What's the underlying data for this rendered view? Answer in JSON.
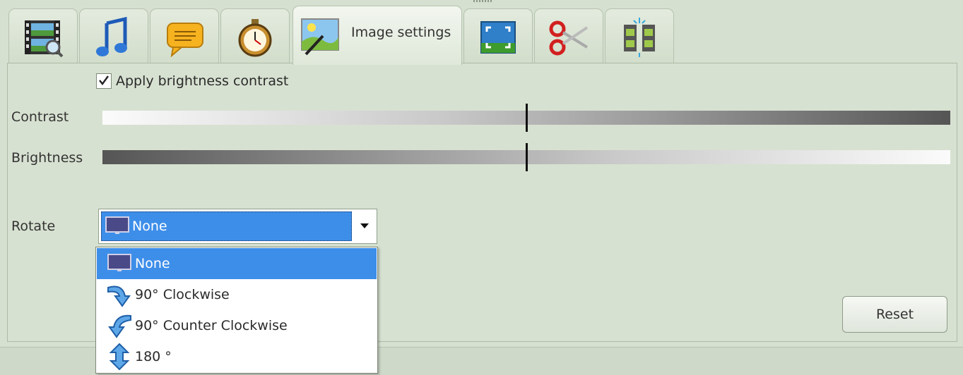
{
  "tabs": [
    {
      "icon": "video-file-icon",
      "label": ""
    },
    {
      "icon": "music-note-icon",
      "label": ""
    },
    {
      "icon": "subtitle-speech-icon",
      "label": ""
    },
    {
      "icon": "stopwatch-icon",
      "label": ""
    },
    {
      "icon": "image-settings-icon",
      "label": "Image settings",
      "active": true
    },
    {
      "icon": "crop-resize-icon",
      "label": ""
    },
    {
      "icon": "scissors-icon",
      "label": ""
    },
    {
      "icon": "film-split-icon",
      "label": ""
    }
  ],
  "image_settings": {
    "apply_brightness_contrast_label": "Apply brightness contrast",
    "apply_brightness_contrast_checked": true,
    "contrast_label": "Contrast",
    "contrast_value": 0.5,
    "brightness_label": "Brightness",
    "brightness_value": 0.5,
    "rotate_label": "Rotate",
    "rotate_selected": "None",
    "rotate_options": [
      "None",
      "90° Clockwise",
      "90° Counter Clockwise",
      "180 °"
    ],
    "reset_label": "Reset"
  },
  "colors": {
    "panel_bg": "#d7e1d1",
    "selection_blue": "#3d8ee9"
  }
}
